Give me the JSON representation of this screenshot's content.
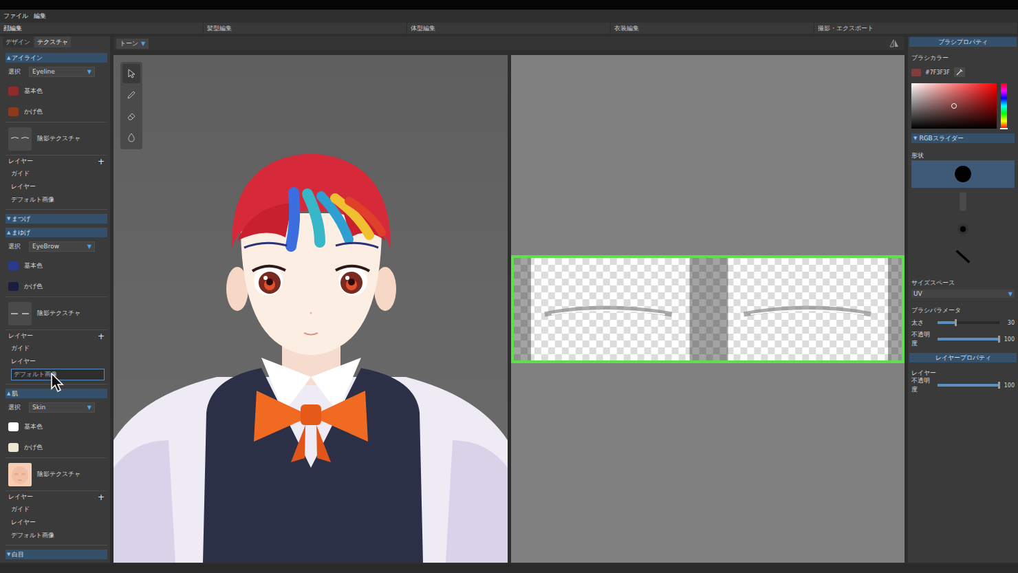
{
  "menu": [
    {
      "label": "ファイル"
    },
    {
      "label": "編集"
    }
  ],
  "modes": [
    {
      "label": "顔編集",
      "selected": true
    },
    {
      "label": "髪型編集",
      "selected": false
    },
    {
      "label": "体型編集",
      "selected": false
    },
    {
      "label": "衣装編集",
      "selected": false
    },
    {
      "label": "撮影・エクスポート",
      "selected": false
    }
  ],
  "left_tabs": [
    {
      "label": "デザイン",
      "selected": false
    },
    {
      "label": "テクスチャ",
      "selected": true
    }
  ],
  "sections": [
    {
      "title": "アイライン",
      "arrow": "▲",
      "expanded": true,
      "select_label": "選択",
      "select_value": "Eyeline",
      "select_arrow": "▼",
      "colors": [
        {
          "label": "基本色",
          "color": "#8e2b2b"
        },
        {
          "label": "かげ色",
          "color": "#8b3a1c"
        }
      ],
      "texture_label": "陰影テクスチャ",
      "texture_kind": "eyeline",
      "layers_label": "レイヤー",
      "add": "+",
      "layers": [
        {
          "label": "ガイド",
          "selected": false
        },
        {
          "label": "レイヤー",
          "selected": false
        },
        {
          "label": "デフォルト画像",
          "selected": false
        }
      ]
    },
    {
      "title": "まつげ",
      "arrow": "▼",
      "expanded": false
    },
    {
      "title": "まゆげ",
      "arrow": "▲",
      "expanded": true,
      "select_label": "選択",
      "select_value": "EyeBrow",
      "select_arrow": "▼",
      "colors": [
        {
          "label": "基本色",
          "color": "#2c3a8c"
        },
        {
          "label": "かげ色",
          "color": "#1c1d3c"
        }
      ],
      "texture_label": "陰影テクスチャ",
      "texture_kind": "eyebrow",
      "layers_label": "レイヤー",
      "add": "+",
      "layers": [
        {
          "label": "ガイド",
          "selected": false
        },
        {
          "label": "レイヤー",
          "selected": false
        },
        {
          "label": "デフォルト画像",
          "selected": true
        }
      ]
    },
    {
      "title": "肌",
      "arrow": "▲",
      "expanded": true,
      "select_label": "選択",
      "select_value": "Skin",
      "select_arrow": "▼",
      "colors": [
        {
          "label": "基本色",
          "color": "#ffffff"
        },
        {
          "label": "かげ色",
          "color": "#efe6d4"
        }
      ],
      "texture_label": "陰影テクスチャ",
      "texture_kind": "skin",
      "layers_label": "レイヤー",
      "add": "+",
      "layers": [
        {
          "label": "ガイド",
          "selected": false
        },
        {
          "label": "レイヤー",
          "selected": false
        },
        {
          "label": "デフォルト画像",
          "selected": false
        }
      ]
    },
    {
      "title": "白目",
      "arrow": "▼",
      "expanded": false
    }
  ],
  "viewport": {
    "mode_label": "トーン",
    "mode_arrow": "▼",
    "tools": [
      {
        "kind": "select",
        "selected": true
      },
      {
        "kind": "pen",
        "selected": false
      },
      {
        "kind": "eraser",
        "selected": false
      },
      {
        "kind": "fill",
        "selected": false
      }
    ]
  },
  "texture": {
    "selected": true
  },
  "brush": {
    "title": "ブラシプロパティ",
    "color_label": "ブラシカラー",
    "color": "#7F3F3F",
    "rgb_label": "RGBスライダー",
    "rgb_arrow": "▼",
    "shape_label": "形状",
    "shapes": [
      {
        "kind": "round",
        "selected": true
      },
      {
        "kind": "soft",
        "selected": false
      },
      {
        "kind": "airbrush",
        "selected": false
      },
      {
        "kind": "line",
        "selected": false
      }
    ],
    "size_space_label": "サイズスペース",
    "size_space": "UV",
    "size_space_arrow": "▼",
    "params_label": "ブラシパラメータ",
    "sliders": [
      {
        "label": "太さ",
        "value": "30",
        "level": 0.3
      },
      {
        "label": "不透明度",
        "value": "100",
        "level": 1
      }
    ]
  },
  "layer_props": {
    "title": "レイヤープロパティ",
    "layer_label": "レイヤー",
    "sliders": [
      {
        "label": "不透明度",
        "value": "100",
        "level": 1
      }
    ]
  }
}
